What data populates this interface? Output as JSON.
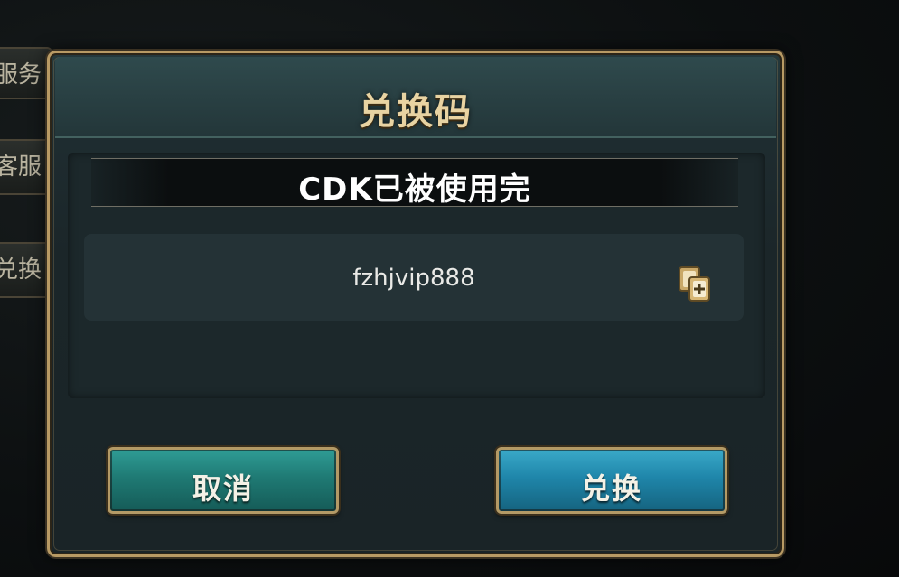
{
  "background_tabs": [
    {
      "label": "服务"
    },
    {
      "label": "客服"
    },
    {
      "label": "兑换"
    }
  ],
  "dialog": {
    "title": "兑换码",
    "status_message": "CDK已被使用完",
    "code_input": {
      "value": "fzhjvip888",
      "paste_icon": "paste-icon"
    },
    "buttons": {
      "cancel_label": "取消",
      "confirm_label": "兑换"
    }
  },
  "colors": {
    "frame_gold": "#b89a64",
    "title_text": "#e8d3a2",
    "cancel_button": "#1f7a74",
    "confirm_button": "#1f86aa"
  }
}
